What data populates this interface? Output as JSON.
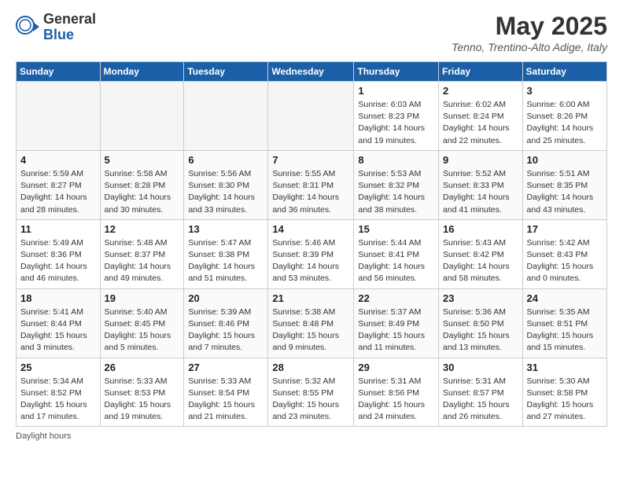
{
  "logo": {
    "general": "General",
    "blue": "Blue"
  },
  "title": "May 2025",
  "location": "Tenno, Trentino-Alto Adige, Italy",
  "days_header": [
    "Sunday",
    "Monday",
    "Tuesday",
    "Wednesday",
    "Thursday",
    "Friday",
    "Saturday"
  ],
  "weeks": [
    [
      {
        "num": "",
        "info": ""
      },
      {
        "num": "",
        "info": ""
      },
      {
        "num": "",
        "info": ""
      },
      {
        "num": "",
        "info": ""
      },
      {
        "num": "1",
        "info": "Sunrise: 6:03 AM\nSunset: 8:23 PM\nDaylight: 14 hours\nand 19 minutes."
      },
      {
        "num": "2",
        "info": "Sunrise: 6:02 AM\nSunset: 8:24 PM\nDaylight: 14 hours\nand 22 minutes."
      },
      {
        "num": "3",
        "info": "Sunrise: 6:00 AM\nSunset: 8:26 PM\nDaylight: 14 hours\nand 25 minutes."
      }
    ],
    [
      {
        "num": "4",
        "info": "Sunrise: 5:59 AM\nSunset: 8:27 PM\nDaylight: 14 hours\nand 28 minutes."
      },
      {
        "num": "5",
        "info": "Sunrise: 5:58 AM\nSunset: 8:28 PM\nDaylight: 14 hours\nand 30 minutes."
      },
      {
        "num": "6",
        "info": "Sunrise: 5:56 AM\nSunset: 8:30 PM\nDaylight: 14 hours\nand 33 minutes."
      },
      {
        "num": "7",
        "info": "Sunrise: 5:55 AM\nSunset: 8:31 PM\nDaylight: 14 hours\nand 36 minutes."
      },
      {
        "num": "8",
        "info": "Sunrise: 5:53 AM\nSunset: 8:32 PM\nDaylight: 14 hours\nand 38 minutes."
      },
      {
        "num": "9",
        "info": "Sunrise: 5:52 AM\nSunset: 8:33 PM\nDaylight: 14 hours\nand 41 minutes."
      },
      {
        "num": "10",
        "info": "Sunrise: 5:51 AM\nSunset: 8:35 PM\nDaylight: 14 hours\nand 43 minutes."
      }
    ],
    [
      {
        "num": "11",
        "info": "Sunrise: 5:49 AM\nSunset: 8:36 PM\nDaylight: 14 hours\nand 46 minutes."
      },
      {
        "num": "12",
        "info": "Sunrise: 5:48 AM\nSunset: 8:37 PM\nDaylight: 14 hours\nand 49 minutes."
      },
      {
        "num": "13",
        "info": "Sunrise: 5:47 AM\nSunset: 8:38 PM\nDaylight: 14 hours\nand 51 minutes."
      },
      {
        "num": "14",
        "info": "Sunrise: 5:46 AM\nSunset: 8:39 PM\nDaylight: 14 hours\nand 53 minutes."
      },
      {
        "num": "15",
        "info": "Sunrise: 5:44 AM\nSunset: 8:41 PM\nDaylight: 14 hours\nand 56 minutes."
      },
      {
        "num": "16",
        "info": "Sunrise: 5:43 AM\nSunset: 8:42 PM\nDaylight: 14 hours\nand 58 minutes."
      },
      {
        "num": "17",
        "info": "Sunrise: 5:42 AM\nSunset: 8:43 PM\nDaylight: 15 hours\nand 0 minutes."
      }
    ],
    [
      {
        "num": "18",
        "info": "Sunrise: 5:41 AM\nSunset: 8:44 PM\nDaylight: 15 hours\nand 3 minutes."
      },
      {
        "num": "19",
        "info": "Sunrise: 5:40 AM\nSunset: 8:45 PM\nDaylight: 15 hours\nand 5 minutes."
      },
      {
        "num": "20",
        "info": "Sunrise: 5:39 AM\nSunset: 8:46 PM\nDaylight: 15 hours\nand 7 minutes."
      },
      {
        "num": "21",
        "info": "Sunrise: 5:38 AM\nSunset: 8:48 PM\nDaylight: 15 hours\nand 9 minutes."
      },
      {
        "num": "22",
        "info": "Sunrise: 5:37 AM\nSunset: 8:49 PM\nDaylight: 15 hours\nand 11 minutes."
      },
      {
        "num": "23",
        "info": "Sunrise: 5:36 AM\nSunset: 8:50 PM\nDaylight: 15 hours\nand 13 minutes."
      },
      {
        "num": "24",
        "info": "Sunrise: 5:35 AM\nSunset: 8:51 PM\nDaylight: 15 hours\nand 15 minutes."
      }
    ],
    [
      {
        "num": "25",
        "info": "Sunrise: 5:34 AM\nSunset: 8:52 PM\nDaylight: 15 hours\nand 17 minutes."
      },
      {
        "num": "26",
        "info": "Sunrise: 5:33 AM\nSunset: 8:53 PM\nDaylight: 15 hours\nand 19 minutes."
      },
      {
        "num": "27",
        "info": "Sunrise: 5:33 AM\nSunset: 8:54 PM\nDaylight: 15 hours\nand 21 minutes."
      },
      {
        "num": "28",
        "info": "Sunrise: 5:32 AM\nSunset: 8:55 PM\nDaylight: 15 hours\nand 23 minutes."
      },
      {
        "num": "29",
        "info": "Sunrise: 5:31 AM\nSunset: 8:56 PM\nDaylight: 15 hours\nand 24 minutes."
      },
      {
        "num": "30",
        "info": "Sunrise: 5:31 AM\nSunset: 8:57 PM\nDaylight: 15 hours\nand 26 minutes."
      },
      {
        "num": "31",
        "info": "Sunrise: 5:30 AM\nSunset: 8:58 PM\nDaylight: 15 hours\nand 27 minutes."
      }
    ]
  ],
  "footer": "Daylight hours"
}
